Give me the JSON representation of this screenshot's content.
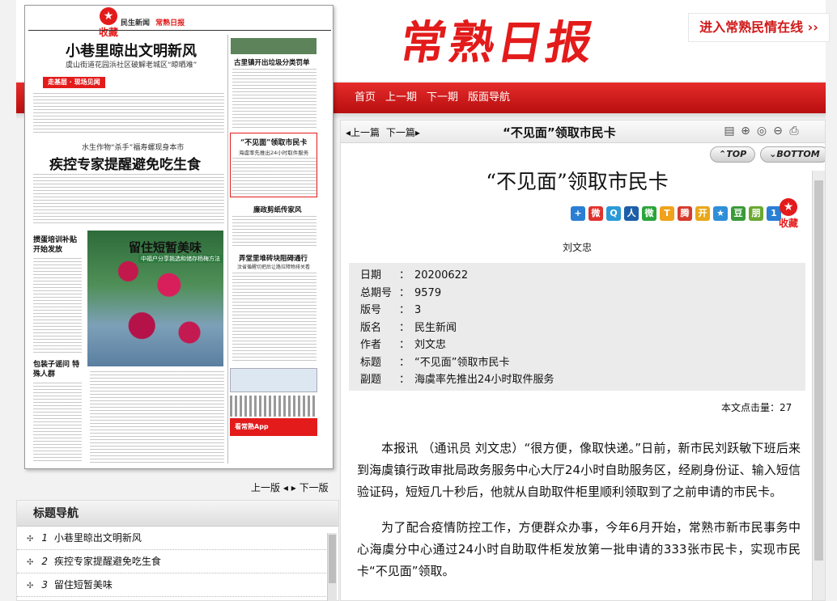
{
  "header": {
    "logo_text": "常熟日报",
    "promo_link": "进入常熟民情在线 ›› "
  },
  "nav": {
    "items": [
      "首页",
      "上一期",
      "下一期",
      "版面导航"
    ]
  },
  "newspaper": {
    "collect_label": "收藏",
    "masthead": "民生新闻",
    "masthead_logo": "常熟日报",
    "head1": "小巷里晾出文明新风",
    "sub1": "虞山街道花园浜社区破解老城区“晾晒难”",
    "column_tag": "走基层 · 现场见闻",
    "kicker2": "水生作物“杀手”福寿螺现身本市",
    "head2": "疾控专家提醒避免吃生食",
    "head3": "留住短暂美味",
    "sub3": "中福户分享挑选和储存杨梅方法",
    "side_head1": "古里镇开出垃圾分类罚单",
    "side_head2": "“不见面”领取市民卡",
    "side_sub2": "海虞率先推出24小时取件服务",
    "side_head3": "廉政剪纸传家风",
    "side_head4": "弄堂里堆砖块阻碍通行",
    "side_sub4": "汶省循醒切把后让路拉障物排关看",
    "left_head1": "掼蛋培训补贴 开始发放",
    "left_head2": "包装子谣问 特殊人群",
    "app_label": "看常熟App"
  },
  "page_pager": {
    "prev": "上一版",
    "next": "下一版"
  },
  "title_nav": {
    "heading": "标题导航",
    "items": [
      {
        "num": "1",
        "title": "小巷里晾出文明新风"
      },
      {
        "num": "2",
        "title": "疾控专家提醒避免吃生食"
      },
      {
        "num": "3",
        "title": "留住短暂美味"
      }
    ]
  },
  "article_bar": {
    "prev": "上一篇",
    "next": "下一篇",
    "title": "“不见面”领取市民卡"
  },
  "top_buttons": {
    "top": "TOP",
    "bottom": "BOTTOM"
  },
  "article": {
    "title": "“不见面”领取市民卡",
    "collect_label": "收藏",
    "author_line": "刘文忠",
    "meta": [
      {
        "key": "日期",
        "value": "20200622"
      },
      {
        "key": "总期号",
        "value": "9579"
      },
      {
        "key": "版号",
        "value": "3"
      },
      {
        "key": "版名",
        "value": "民生新闻"
      },
      {
        "key": "作者",
        "value": "刘文忠"
      },
      {
        "key": "标题",
        "value": "“不见面”领取市民卡"
      },
      {
        "key": "副题",
        "value": "海虞率先推出24小时取件服务"
      }
    ],
    "clicks_label": "本文点击量：",
    "clicks_value": "27",
    "paragraphs": [
      "本报讯 （通讯员 刘文忠）“很方便，像取快递。”日前，新市民刘跃敏下班后来到海虞镇行政审批局政务服务中心大厅24小时自助服务区，经刷身份证、输入短信验证码，短短几十秒后，他就从自助取件柜里顺利领取到了之前申请的市民卡。",
      "为了配合疫情防控工作，方便群众办事，今年6月开始，常熟市新市民事务中心海虞分中心通过24小时自助取件柜发放第一批申请的333张市民卡，实现市民卡“不见面”领取。"
    ]
  },
  "share_icons": [
    {
      "name": "plus-share-icon",
      "glyph": "+",
      "color": "#2a7fd4"
    },
    {
      "name": "weibo-icon",
      "glyph": "微",
      "color": "#e0322d"
    },
    {
      "name": "qzone-icon",
      "glyph": "Q",
      "color": "#2a9ad8"
    },
    {
      "name": "renren-icon",
      "glyph": "人",
      "color": "#1c5ea8"
    },
    {
      "name": "wechat-icon",
      "glyph": "微",
      "color": "#2aa53a"
    },
    {
      "name": "tqq-icon",
      "glyph": "T",
      "color": "#f0a21a"
    },
    {
      "name": "tweibo-icon",
      "glyph": "腾",
      "color": "#d53b2d"
    },
    {
      "name": "kaixin-icon",
      "glyph": "开",
      "color": "#e8a81a"
    },
    {
      "name": "star-share-icon",
      "glyph": "★",
      "color": "#2f8fd8"
    },
    {
      "name": "douban-icon",
      "glyph": "豆",
      "color": "#3a9a3a"
    },
    {
      "name": "pengyou-icon",
      "glyph": "朋",
      "color": "#6aa830"
    },
    {
      "name": "one-share-icon",
      "glyph": "1",
      "color": "#2a7fd4"
    }
  ],
  "tool_icons": [
    "notes-icon",
    "zoom-in-icon",
    "zoom-reset-icon",
    "zoom-out-icon",
    "print-icon"
  ]
}
